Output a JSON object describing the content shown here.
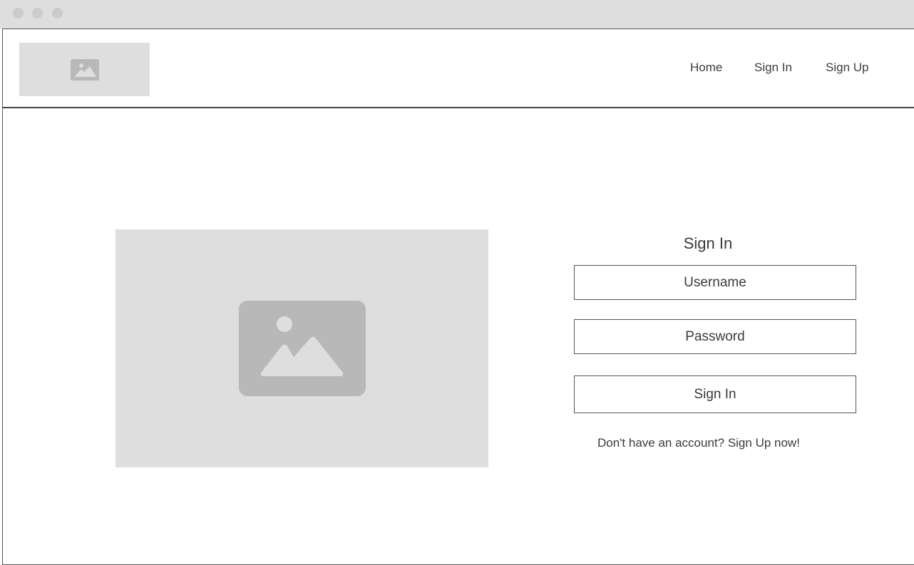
{
  "window": {
    "controls": [
      "close",
      "minimize",
      "maximize"
    ]
  },
  "header": {
    "logo_icon": "image-placeholder-icon",
    "nav": {
      "home": "Home",
      "sign_in": "Sign In",
      "sign_up": "Sign Up"
    }
  },
  "hero": {
    "icon": "image-placeholder-icon"
  },
  "signin_form": {
    "title": "Sign In",
    "username": "Username",
    "password": "Password",
    "submit": "Sign In",
    "signup_prompt": "Don't have an account? Sign Up now!"
  },
  "colors": {
    "placeholder_bg": "#dedede",
    "placeholder_icon": "#b8b8b8",
    "titlebar": "#dedede",
    "border": "#555555",
    "text": "#3a3a3a"
  }
}
